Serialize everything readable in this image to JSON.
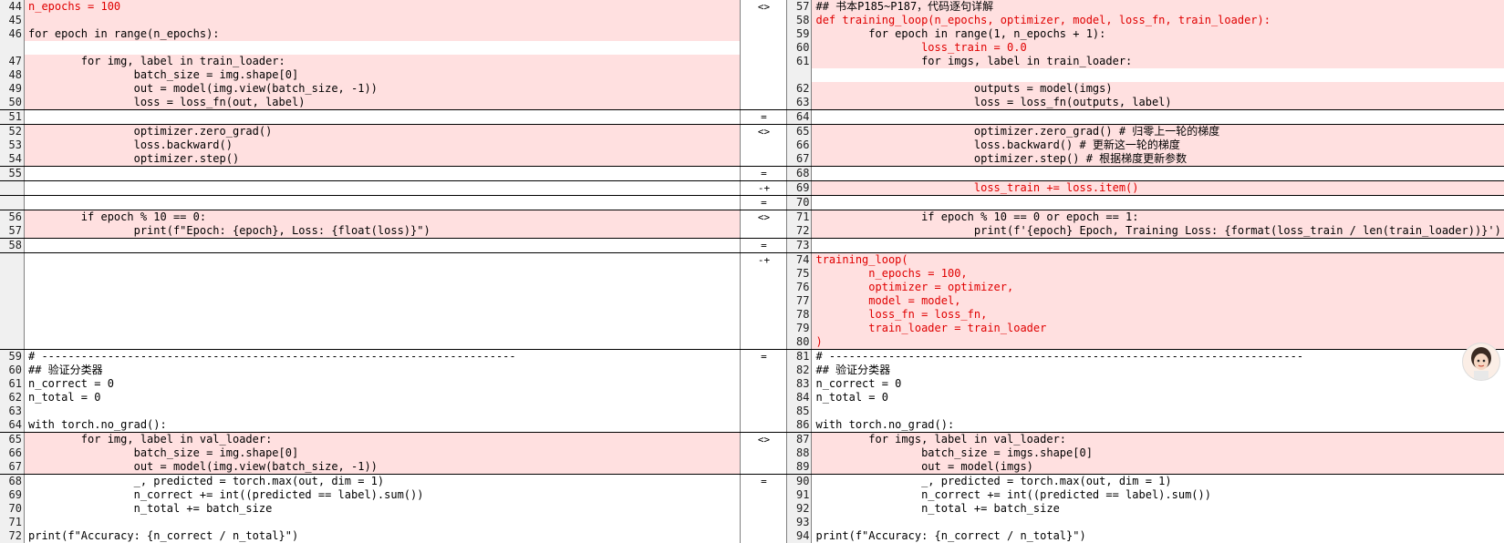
{
  "rows": [
    {
      "l": {
        "n": "44",
        "t": "n_epochs = 100",
        "c": 1,
        "r": 1
      },
      "m": "<>",
      "r": {
        "n": "57",
        "t": "## 书本P185~P187，代码逐句详解",
        "c": 1
      }
    },
    {
      "l": {
        "n": "45",
        "t": "",
        "c": 1
      },
      "m": "",
      "r": {
        "n": "58",
        "t": "def training_loop(n_epochs, optimizer, model, loss_fn, train_loader):",
        "c": 1,
        "r": 1
      }
    },
    {
      "l": {
        "n": "46",
        "t": "for epoch in range(n_epochs):",
        "c": 1
      },
      "m": "",
      "r": {
        "n": "59",
        "t": "        for epoch in range(1, n_epochs + 1):",
        "c": 1
      }
    },
    {
      "l": {
        "n": "",
        "t": "",
        "c": 0
      },
      "m": "",
      "r": {
        "n": "60",
        "t": "                loss_train = 0.0",
        "c": 1,
        "r": 1
      }
    },
    {
      "l": {
        "n": "47",
        "t": "        for img, label in train_loader:",
        "c": 1
      },
      "m": "",
      "r": {
        "n": "61",
        "t": "                for imgs, label in train_loader:",
        "c": 1
      }
    },
    {
      "l": {
        "n": "48",
        "t": "                batch_size = img.shape[0]",
        "c": 1
      },
      "m": "",
      "r": {
        "n": "",
        "t": "",
        "c": 0
      }
    },
    {
      "l": {
        "n": "49",
        "t": "                out = model(img.view(batch_size, -1))",
        "c": 1
      },
      "m": "",
      "r": {
        "n": "62",
        "t": "                        outputs = model(imgs)",
        "c": 1
      }
    },
    {
      "l": {
        "n": "50",
        "t": "                loss = loss_fn(out, label)",
        "c": 1
      },
      "m": "",
      "r": {
        "n": "63",
        "t": "                        loss = loss_fn(outputs, label)",
        "c": 1
      }
    },
    {
      "l": {
        "n": "51",
        "t": "",
        "c": 0
      },
      "m": "=",
      "r": {
        "n": "64",
        "t": "",
        "c": 0
      },
      "sep": 1
    },
    {
      "l": {
        "n": "52",
        "t": "                optimizer.zero_grad()",
        "c": 1
      },
      "m": "<>",
      "r": {
        "n": "65",
        "t": "                        optimizer.zero_grad() # 归零上一轮的梯度",
        "c": 1
      },
      "sep": 1
    },
    {
      "l": {
        "n": "53",
        "t": "                loss.backward()",
        "c": 1
      },
      "m": "",
      "r": {
        "n": "66",
        "t": "                        loss.backward() # 更新这一轮的梯度",
        "c": 1
      }
    },
    {
      "l": {
        "n": "54",
        "t": "                optimizer.step()",
        "c": 1
      },
      "m": "",
      "r": {
        "n": "67",
        "t": "                        optimizer.step() # 根据梯度更新参数",
        "c": 1
      }
    },
    {
      "l": {
        "n": "55",
        "t": "",
        "c": 0
      },
      "m": "=",
      "r": {
        "n": "68",
        "t": "",
        "c": 0
      },
      "sep": 1
    },
    {
      "l": {
        "n": "",
        "t": "",
        "c": 0,
        "e": 1
      },
      "m": "-+",
      "r": {
        "n": "69",
        "t": "                        loss_train += loss.item()",
        "c": 1,
        "r": 1
      },
      "sep": 1
    },
    {
      "l": {
        "n": "",
        "t": "",
        "c": 0,
        "e": 1
      },
      "m": "=",
      "r": {
        "n": "70",
        "t": "",
        "c": 0
      },
      "sep": 1
    },
    {
      "l": {
        "n": "56",
        "t": "        if epoch % 10 == 0:",
        "c": 1
      },
      "m": "<>",
      "r": {
        "n": "71",
        "t": "                if epoch % 10 == 0 or epoch == 1:",
        "c": 1
      },
      "sep": 1
    },
    {
      "l": {
        "n": "57",
        "t": "                print(f\"Epoch: {epoch}, Loss: {float(loss)}\")",
        "c": 1
      },
      "m": "",
      "r": {
        "n": "72",
        "t": "                        print(f'{epoch} Epoch, Training Loss: {format(loss_train / len(train_loader))}')",
        "c": 1
      }
    },
    {
      "l": {
        "n": "58",
        "t": "",
        "c": 0
      },
      "m": "=",
      "r": {
        "n": "73",
        "t": "",
        "c": 0
      },
      "sep": 1
    },
    {
      "l": {
        "n": "",
        "t": "",
        "c": 0,
        "e": 1
      },
      "m": "-+",
      "r": {
        "n": "74",
        "t": "training_loop(",
        "c": 1,
        "r": 1
      },
      "sep": 1
    },
    {
      "l": {
        "n": "",
        "t": "",
        "c": 0,
        "e": 1
      },
      "m": "",
      "r": {
        "n": "75",
        "t": "        n_epochs = 100,",
        "c": 1,
        "r": 1
      }
    },
    {
      "l": {
        "n": "",
        "t": "",
        "c": 0,
        "e": 1
      },
      "m": "",
      "r": {
        "n": "76",
        "t": "        optimizer = optimizer,",
        "c": 1,
        "r": 1
      }
    },
    {
      "l": {
        "n": "",
        "t": "",
        "c": 0,
        "e": 1
      },
      "m": "",
      "r": {
        "n": "77",
        "t": "        model = model,",
        "c": 1,
        "r": 1
      }
    },
    {
      "l": {
        "n": "",
        "t": "",
        "c": 0,
        "e": 1
      },
      "m": "",
      "r": {
        "n": "78",
        "t": "        loss_fn = loss_fn,",
        "c": 1,
        "r": 1
      }
    },
    {
      "l": {
        "n": "",
        "t": "",
        "c": 0,
        "e": 1
      },
      "m": "",
      "r": {
        "n": "79",
        "t": "        train_loader = train_loader",
        "c": 1,
        "r": 1
      }
    },
    {
      "l": {
        "n": "",
        "t": "",
        "c": 0,
        "e": 1
      },
      "m": "",
      "r": {
        "n": "80",
        "t": ")",
        "c": 1,
        "r": 1
      }
    },
    {
      "l": {
        "n": "59",
        "t": "# ------------------------------------------------------------------------",
        "c": 0
      },
      "m": "=",
      "r": {
        "n": "81",
        "t": "# ------------------------------------------------------------------------",
        "c": 0
      },
      "sep": 1
    },
    {
      "l": {
        "n": "60",
        "t": "## 验证分类器",
        "c": 0
      },
      "m": "",
      "r": {
        "n": "82",
        "t": "## 验证分类器",
        "c": 0
      }
    },
    {
      "l": {
        "n": "61",
        "t": "n_correct = 0",
        "c": 0
      },
      "m": "",
      "r": {
        "n": "83",
        "t": "n_correct = 0",
        "c": 0
      }
    },
    {
      "l": {
        "n": "62",
        "t": "n_total = 0",
        "c": 0
      },
      "m": "",
      "r": {
        "n": "84",
        "t": "n_total = 0",
        "c": 0
      }
    },
    {
      "l": {
        "n": "63",
        "t": "",
        "c": 0
      },
      "m": "",
      "r": {
        "n": "85",
        "t": "",
        "c": 0
      }
    },
    {
      "l": {
        "n": "64",
        "t": "with torch.no_grad():",
        "c": 0
      },
      "m": "",
      "r": {
        "n": "86",
        "t": "with torch.no_grad():",
        "c": 0
      }
    },
    {
      "l": {
        "n": "65",
        "t": "        for img, label in val_loader:",
        "c": 1
      },
      "m": "<>",
      "r": {
        "n": "87",
        "t": "        for imgs, label in val_loader:",
        "c": 1
      },
      "sep": 1
    },
    {
      "l": {
        "n": "66",
        "t": "                batch_size = img.shape[0]",
        "c": 1
      },
      "m": "",
      "r": {
        "n": "88",
        "t": "                batch_size = imgs.shape[0]",
        "c": 1
      }
    },
    {
      "l": {
        "n": "67",
        "t": "                out = model(img.view(batch_size, -1))",
        "c": 1
      },
      "m": "",
      "r": {
        "n": "89",
        "t": "                out = model(imgs)",
        "c": 1
      }
    },
    {
      "l": {
        "n": "68",
        "t": "                _, predicted = torch.max(out, dim = 1)",
        "c": 0
      },
      "m": "=",
      "r": {
        "n": "90",
        "t": "                _, predicted = torch.max(out, dim = 1)",
        "c": 0
      },
      "sep": 1
    },
    {
      "l": {
        "n": "69",
        "t": "                n_correct += int((predicted == label).sum())",
        "c": 0
      },
      "m": "",
      "r": {
        "n": "91",
        "t": "                n_correct += int((predicted == label).sum())",
        "c": 0
      }
    },
    {
      "l": {
        "n": "70",
        "t": "                n_total += batch_size",
        "c": 0
      },
      "m": "",
      "r": {
        "n": "92",
        "t": "                n_total += batch_size",
        "c": 0
      }
    },
    {
      "l": {
        "n": "71",
        "t": "",
        "c": 0
      },
      "m": "",
      "r": {
        "n": "93",
        "t": "",
        "c": 0
      }
    },
    {
      "l": {
        "n": "72",
        "t": "print(f\"Accuracy: {n_correct / n_total}\")",
        "c": 0
      },
      "m": "",
      "r": {
        "n": "94",
        "t": "print(f\"Accuracy: {n_correct / n_total}\")",
        "c": 0
      }
    }
  ],
  "colors": {
    "changed_bg": "#ffe0e0",
    "removed_text": "#e00000",
    "number": "#008000"
  },
  "avatar": {
    "icon": "assistant-avatar-icon"
  }
}
